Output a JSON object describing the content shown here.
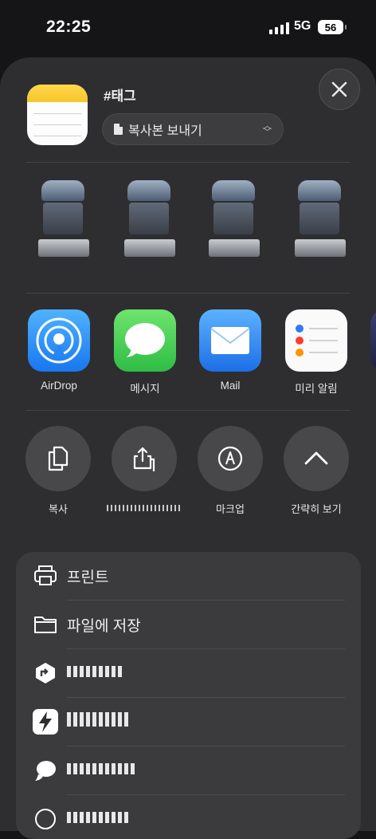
{
  "status_bar": {
    "time": "22:25",
    "network": "5G",
    "battery": "56"
  },
  "share_sheet": {
    "title": "#태그",
    "send_mode": "복사본 보내기",
    "apps": [
      {
        "label": "AirDrop",
        "icon": "airdrop-icon",
        "color": "#1e8cff"
      },
      {
        "label": "메시지",
        "icon": "messages-icon",
        "color": "#34c759"
      },
      {
        "label": "Mail",
        "icon": "mail-icon",
        "color": "#2f8df7"
      },
      {
        "label": "미리 알림",
        "icon": "reminders-icon",
        "color": "#ffffff"
      }
    ],
    "actions": [
      {
        "label": "복사",
        "icon": "copy-icon"
      },
      {
        "label": "",
        "icon": "share-export-icon"
      },
      {
        "label": "마크업",
        "icon": "markup-pen-icon"
      },
      {
        "label": "간략히 보기",
        "icon": "chevron-up-icon"
      }
    ],
    "list_items": [
      {
        "label": "프린트",
        "icon": "printer-icon"
      },
      {
        "label": "파일에 저장",
        "icon": "folder-icon"
      },
      {
        "label": "",
        "icon": "app-shortcut-icon"
      },
      {
        "label": "",
        "icon": "app-bolt-icon"
      },
      {
        "label": "",
        "icon": "app-chat-icon"
      }
    ]
  }
}
